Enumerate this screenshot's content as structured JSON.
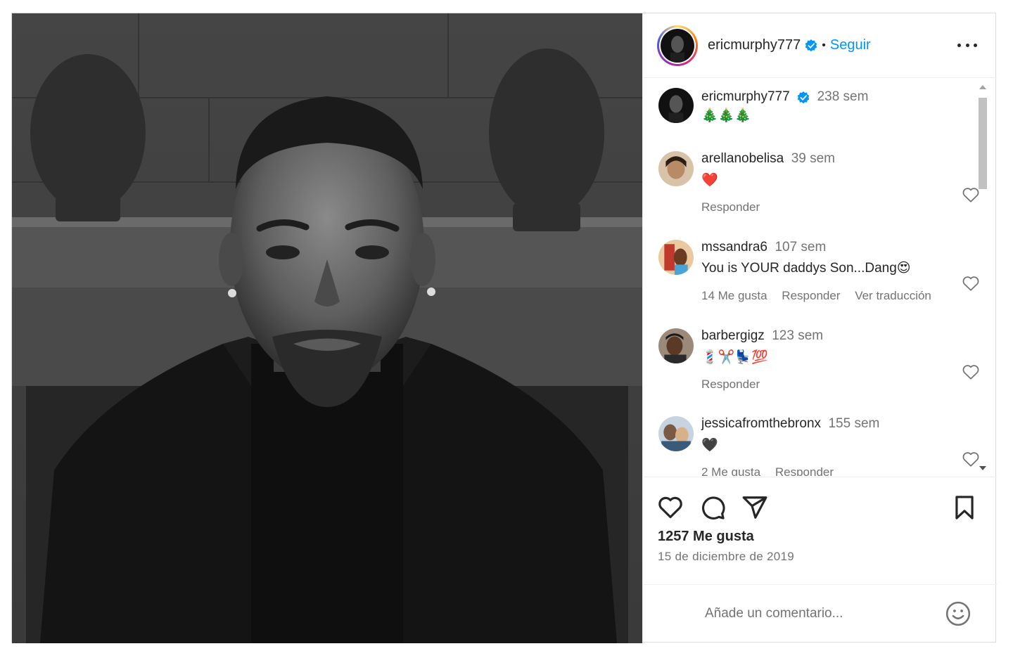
{
  "post": {
    "author": "ericmurphy777",
    "follow_label": "Seguir",
    "dot": "•",
    "caption": {
      "username": "ericmurphy777",
      "ago": "238 sem",
      "text": "🎄🎄🎄"
    },
    "comments": [
      {
        "username": "arellanobelisa",
        "ago": "39 sem",
        "text": "❤️",
        "meta": [
          "Responder"
        ]
      },
      {
        "username": "mssandra6",
        "ago": "107 sem",
        "text": "You is YOUR daddys Son...Dang😍",
        "meta": [
          "14 Me gusta",
          "Responder",
          "Ver traducción"
        ]
      },
      {
        "username": "barbergigz",
        "ago": "123 sem",
        "text": "💈✂️💺💯",
        "meta": [
          "Responder"
        ]
      },
      {
        "username": "jessicafromthebronx",
        "ago": "155 sem",
        "text": "🖤",
        "meta": [
          "2 Me gusta",
          "Responder"
        ]
      }
    ],
    "likes": "1257 Me gusta",
    "date": "15 de diciembre de 2019",
    "add_comment_placeholder": "Añade un comentario..."
  },
  "icons": {
    "like": "heart-icon",
    "comment": "comment-icon",
    "share": "share-icon",
    "save": "bookmark-icon",
    "more": "more-options-icon",
    "verified": "verified-badge-icon",
    "emoji": "emoji-icon"
  },
  "colors": {
    "accent": "#0095f6",
    "verified": "#0095f6",
    "text": "#262626",
    "muted": "#737373"
  }
}
